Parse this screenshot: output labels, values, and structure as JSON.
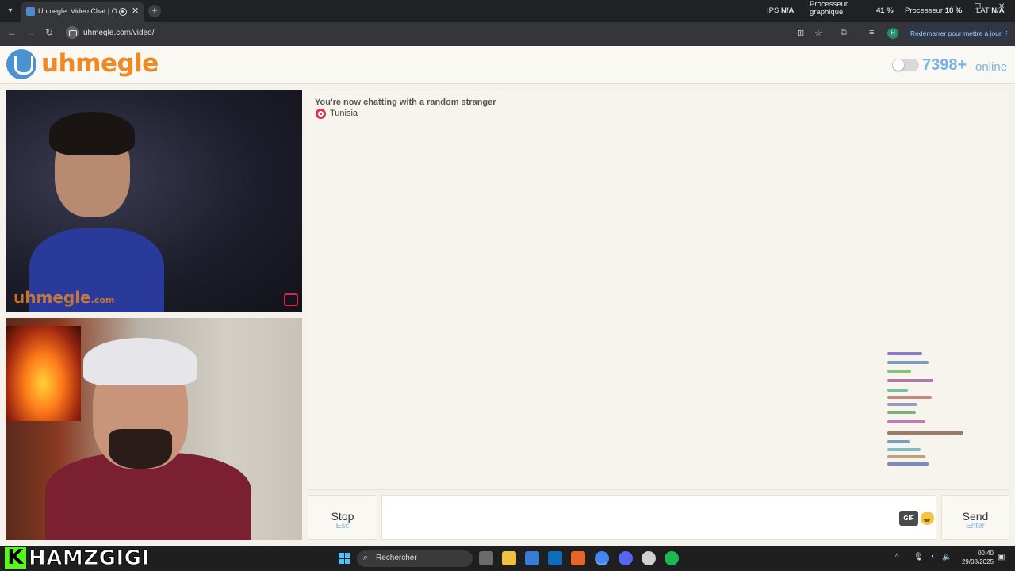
{
  "browser": {
    "tab_title": "Uhmegle: Video Chat | Ome",
    "new_tab_symbol": "+",
    "close_symbol": "✕",
    "url": "uhmegle.com/video/",
    "restart_label": "Redémarrer pour mettre à jour",
    "profile_initial": "H",
    "window_controls": [
      "—",
      "❐",
      "✕"
    ]
  },
  "overlay": {
    "ips_label": "IPS",
    "ips_value": "N/A",
    "gpu_label_1": "Processeur",
    "gpu_label_2": "graphique",
    "gpu_value": "41 %",
    "cpu_label": "Processeur",
    "cpu_value": "18 %",
    "lat_label": "LAT",
    "lat_value": "N/A"
  },
  "header": {
    "logo_text": "uhmegle",
    "online_count": "7398+",
    "online_label": "online"
  },
  "videos": {
    "watermark_main": "uhmegle",
    "watermark_suffix": ".com"
  },
  "chat": {
    "status": "You're now chatting with a random stranger",
    "country": "Tunisia"
  },
  "controls": {
    "stop_label": "Stop",
    "stop_hint": "Esc",
    "gif_label": "GIF",
    "send_label": "Send",
    "send_hint": "Enter"
  },
  "taskbar": {
    "streamer_k": "K",
    "streamer_name": "HAMZGIGI",
    "search_placeholder": "Rechercher",
    "time": "00:40",
    "date": "29/08/2025"
  },
  "colors": {
    "accent_orange": "#ee8a25",
    "accent_blue": "#7ab3e2",
    "page_bg": "#f4f2ea",
    "kick_green": "#53fc18"
  }
}
